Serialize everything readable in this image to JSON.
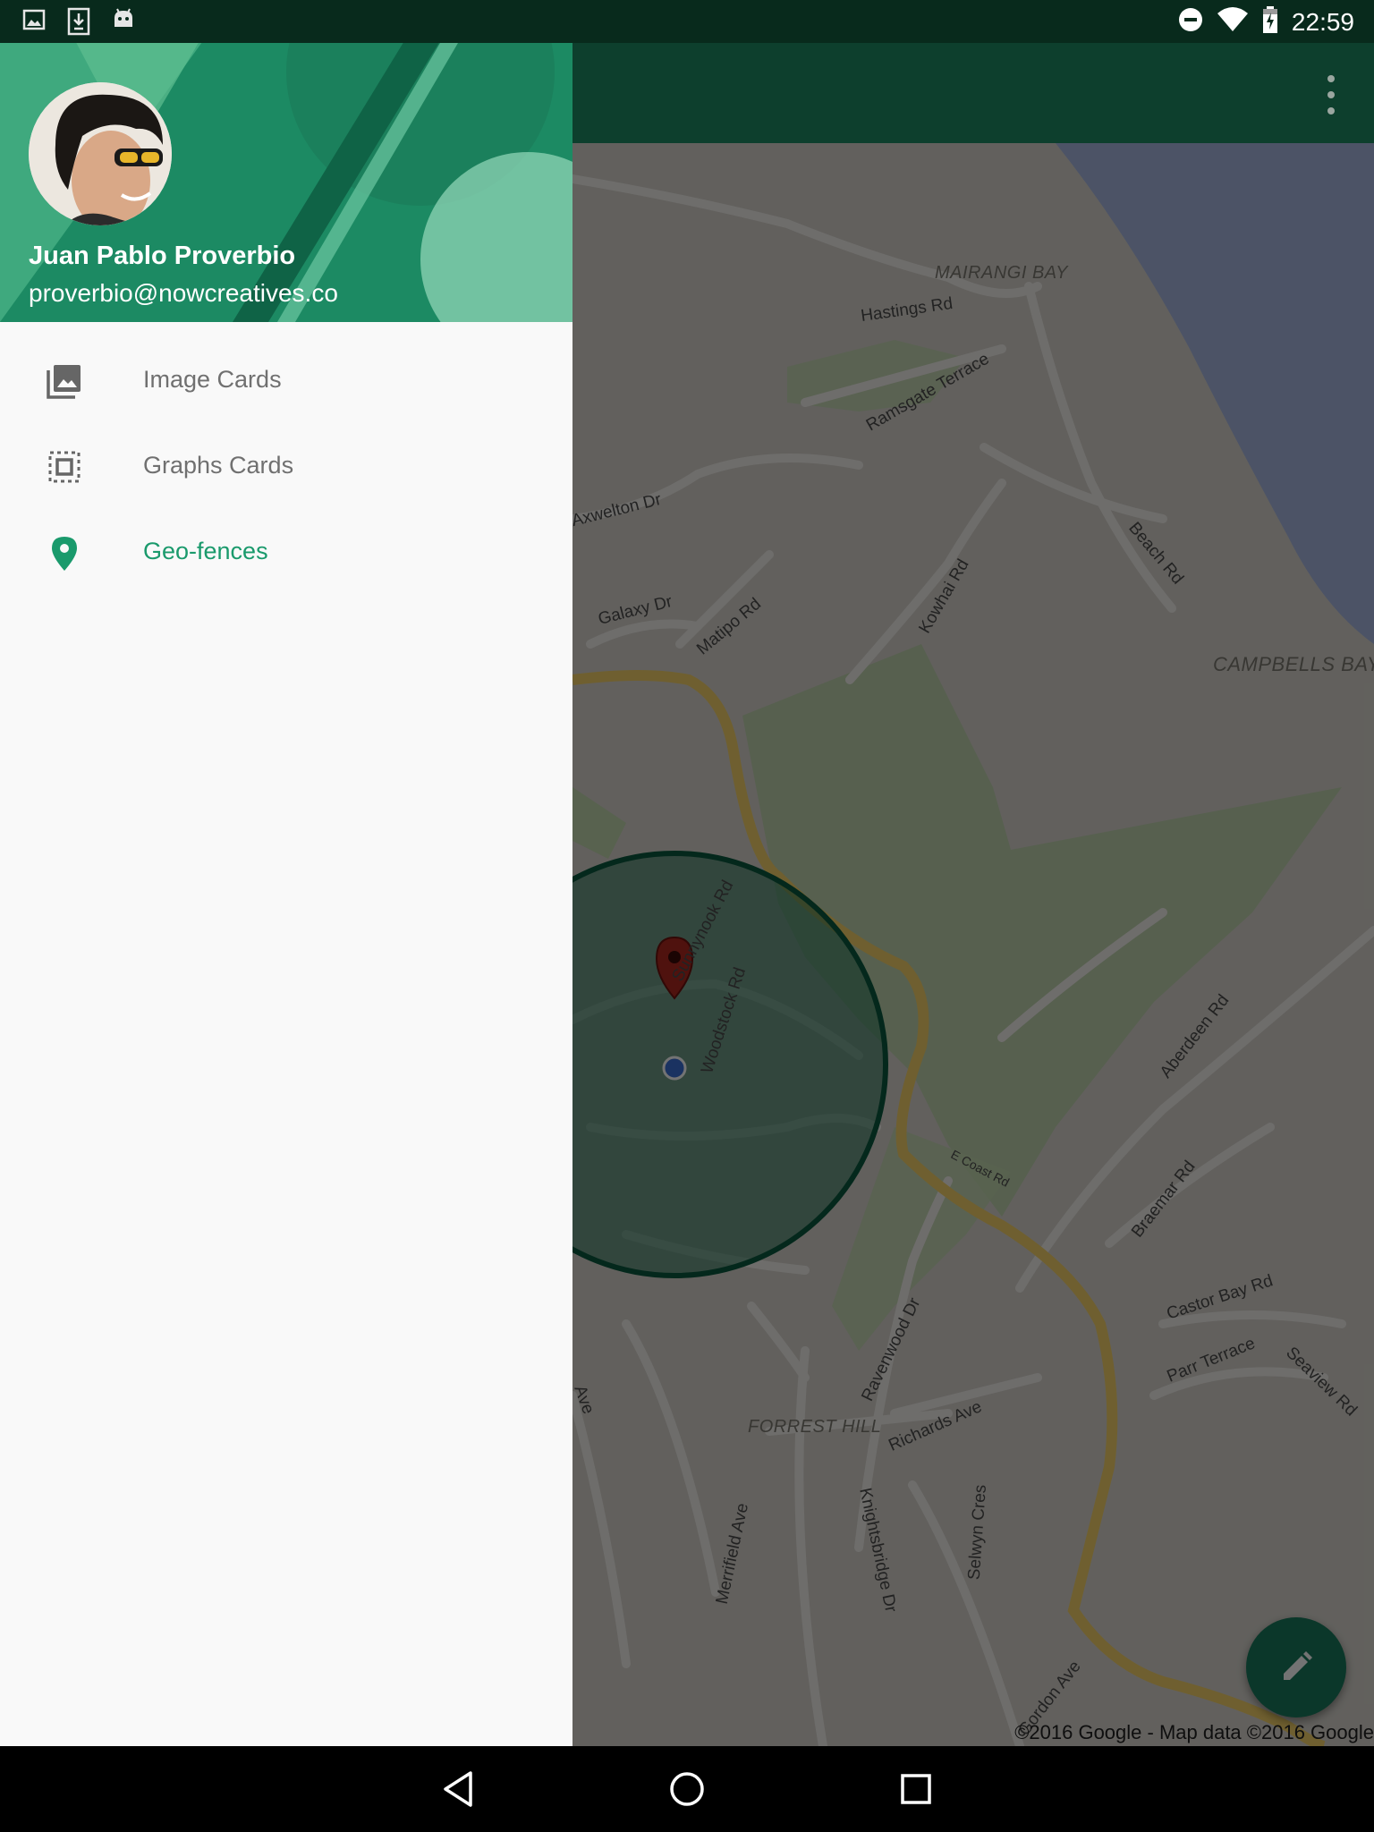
{
  "status_bar": {
    "time": "22:59",
    "left_icons": [
      "image-icon",
      "download-icon",
      "android-icon"
    ],
    "right_icons": [
      "do-not-disturb-icon",
      "wifi-icon",
      "battery-charging-icon"
    ]
  },
  "drawer": {
    "user": {
      "name": "Juan Pablo Proverbio",
      "email": "proverbio@nowcreatives.co"
    },
    "items": [
      {
        "label": "Image Cards",
        "icon": "photo-library-icon",
        "active": false
      },
      {
        "label": "Graphs Cards",
        "icon": "select-all-icon",
        "active": false
      },
      {
        "label": "Geo-fences",
        "icon": "place-icon",
        "active": true
      }
    ],
    "accent_color": "#1a9a6c"
  },
  "map": {
    "area_labels": [
      "MAIRANGI BAY",
      "CAMPBELLS BAY",
      "FORREST HILL"
    ],
    "street_labels": [
      "Hastings Rd",
      "Ramsgate Terrace",
      "Axwelton Dr",
      "Beach Rd",
      "Kowhai Rd",
      "Galaxy Dr",
      "Matipo Rd",
      "Sunnynook Rd",
      "Woodstock Rd",
      "E Coast Rd",
      "Aberdeen Rd",
      "Braemar Rd",
      "Castor Bay Rd",
      "Parr Terrace",
      "Seaview Rd",
      "Ravenwood Dr",
      "Richards Ave",
      "Merrifield Ave",
      "Knightsbridge Dr",
      "Selwyn Cres",
      "Gordon Ave",
      "Ave"
    ],
    "copyright": "©2016 Google - Map data ©2016 Google",
    "geofence_color": "#0b5a3e",
    "marker_color": "#b0281f"
  },
  "toolbar": {
    "color": "#0d3f2d",
    "overflow_icon": "more-vert-icon"
  },
  "fab": {
    "icon": "pencil-icon"
  },
  "navigation_bar": {
    "buttons": [
      "back-icon",
      "home-icon",
      "recents-icon"
    ]
  }
}
